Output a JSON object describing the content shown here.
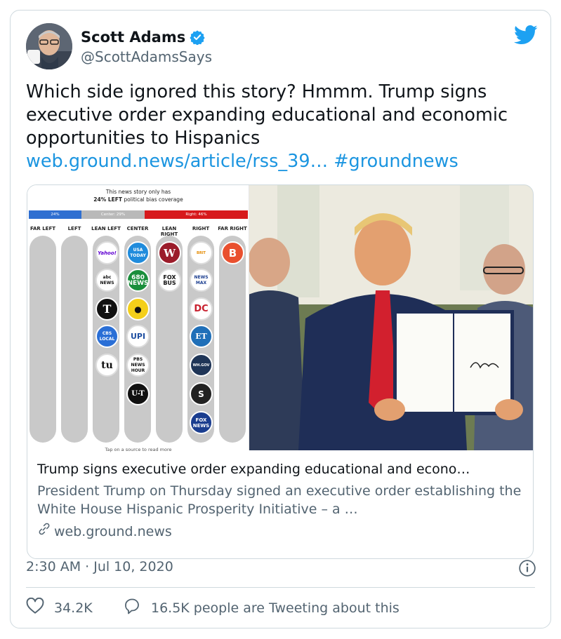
{
  "author": {
    "name": "Scott Adams",
    "handle": "@ScottAdamsSays"
  },
  "tweet": {
    "text": "Which side ignored this story? Hmmm. Trump signs executive order expanding educational and economic opportunities to Hispanics",
    "link": "web.ground.news/article/rss_39…",
    "hashtag": "#groundnews"
  },
  "chart": {
    "title_line1": "This news story only has",
    "title_bold": "24% LEFT",
    "title_rest": " political bias coverage",
    "bar": [
      {
        "label": "24%",
        "fraction": 0.24,
        "color": "#2f6fd1"
      },
      {
        "label": "Center: 29%",
        "fraction": 0.29,
        "color": "#b9b9b9"
      },
      {
        "label": "Right: 46%",
        "fraction": 0.47,
        "color": "#d7191c"
      }
    ],
    "columns": [
      "FAR LEFT",
      "LEFT",
      "LEAN LEFT",
      "CENTER",
      "LEAN RIGHT",
      "RIGHT",
      "FAR RIGHT"
    ],
    "footer": "Tap on a source to read more"
  },
  "card": {
    "title": "Trump signs executive order expanding educational and econo…",
    "description": "President Trump on Thursday signed an executive order establishing the White House Hispanic Prosperity Initiative – a …",
    "domain": "web.ground.news"
  },
  "meta": {
    "timestamp": "2:30 AM · Jul 10, 2020"
  },
  "actions": {
    "likes": "34.2K",
    "retweets": "16.5K people are Tweeting about this"
  },
  "colors": {
    "link": "#1b95e0",
    "twitter_blue": "#1da1f2",
    "secondary_text": "#536471"
  },
  "icons": [
    "verified-icon",
    "twitter-bird-icon",
    "link-icon",
    "info-icon",
    "heart-icon",
    "comment-icon"
  ]
}
